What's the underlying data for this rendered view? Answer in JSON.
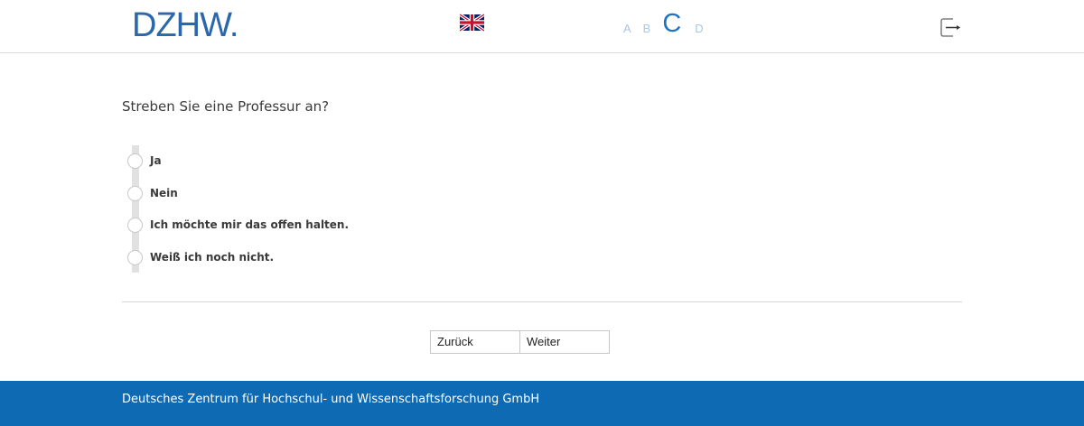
{
  "header": {
    "logo_text": "DZHW",
    "logo_dot": ".",
    "language_flag_icon": "uk-flag-icon",
    "sections": [
      "A",
      "B",
      "C",
      "D"
    ],
    "active_section": "C",
    "exit_icon": "exit-icon"
  },
  "survey": {
    "question": "Streben Sie eine Professur an?",
    "options": [
      {
        "label": "Ja"
      },
      {
        "label": "Nein"
      },
      {
        "label": "Ich möchte mir das offen halten."
      },
      {
        "label": "Weiß ich noch nicht."
      }
    ]
  },
  "navigation": {
    "back_label": "Zurück",
    "next_label": "Weiter"
  },
  "footer": {
    "text": "Deutsches Zentrum für Hochschul- und Wissenschaftsforschung GmbH"
  },
  "colors": {
    "brand_blue": "#2a67ac",
    "footer_blue": "#0f6ab4",
    "inactive_section": "#a8c8e6"
  }
}
